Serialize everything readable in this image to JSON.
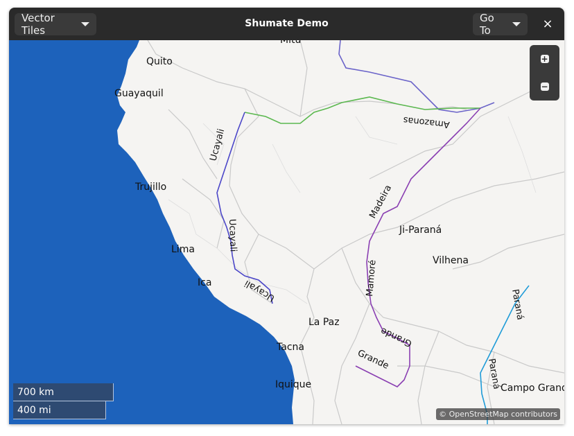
{
  "window": {
    "title": "Shumate Demo",
    "style_button_label": "Vector Tiles",
    "goto_button_label": "Go To",
    "close_glyph": "×"
  },
  "map": {
    "zoom_in_glyph": "+",
    "zoom_out_glyph": "−",
    "scale_km": "700 km",
    "scale_mi": "400 mi",
    "attribution": "© OpenStreetMap contributors",
    "colors": {
      "ocean": "#1d62bb",
      "land": "#f5f4f2",
      "border": "#c8c8c8"
    },
    "cities": {
      "mitu": "Mitú",
      "quito": "Quito",
      "guayaquil": "Guayaquil",
      "trujillo": "Trujillo",
      "lima": "Lima",
      "ica": "Ica",
      "la_paz": "La Paz",
      "tacna": "Tacna",
      "iquique": "Iquique",
      "ji_parana": "Ji-Paraná",
      "vilhena": "Vilhena",
      "campo_grande": "Campo Grand"
    },
    "rivers": {
      "amazonas": "Amazonas",
      "ucayali_1": "Ucayali",
      "ucayali_2": "Ucayali",
      "ucayali_3": "Ucayali",
      "madeira": "Madeira",
      "mamore": "Mamoré",
      "grande_1": "Grande",
      "grande_2": "Grande",
      "parana_1": "Paraná",
      "parana_2": "Paraná"
    }
  }
}
